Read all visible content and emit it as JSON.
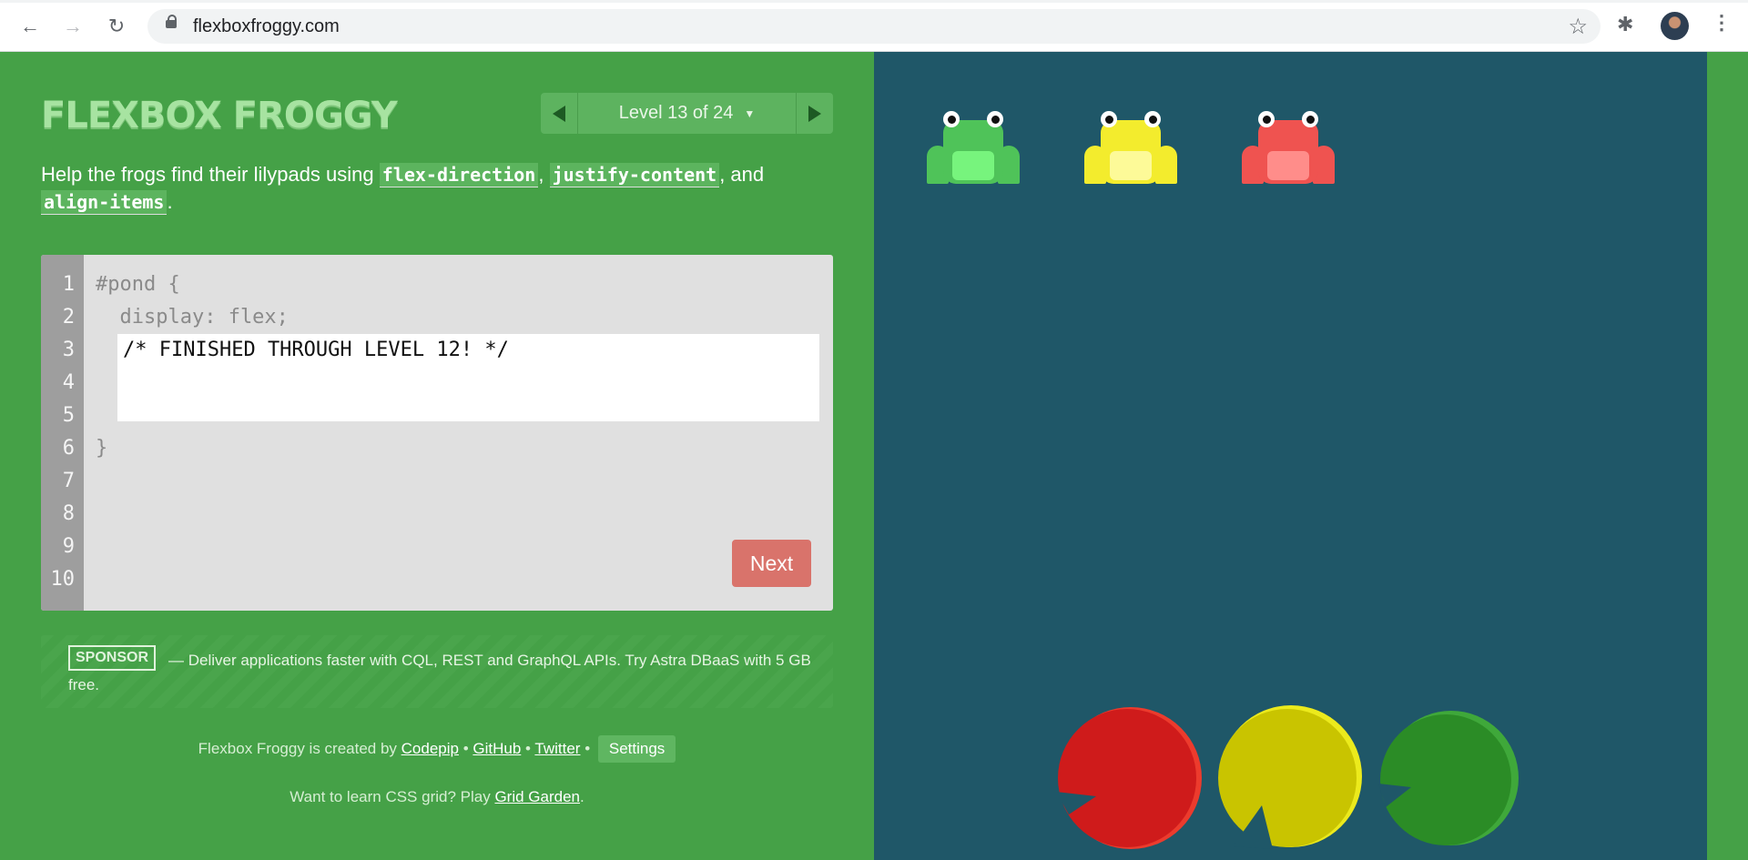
{
  "browser": {
    "url": "flexboxfroggy.com",
    "back_icon": "←",
    "forward_icon": "→",
    "reload_icon": "↻",
    "star_icon": "☆",
    "extensions_icon": "✱",
    "menu_icon": "⋮"
  },
  "game": {
    "logo": "FLEXBOX FROGGY",
    "level_label": "Level 13 of 24",
    "level_caret": "▼",
    "intro_prefix": "Help the frogs find their lilypads using ",
    "intro_code1": "flex-direction",
    "intro_sep1": ", ",
    "intro_code2": "justify-content",
    "intro_sep2": ", and ",
    "intro_code3": "align-items",
    "intro_suffix": ".",
    "editor": {
      "line_numbers": [
        "1",
        "2",
        "3",
        "4",
        "5",
        "6",
        "7",
        "8",
        "9",
        "10"
      ],
      "line1": "#pond {",
      "line2": "  display: flex;",
      "input_value": "/* FINISHED THROUGH LEVEL 12! */",
      "line6": "}"
    },
    "next_label": "Next",
    "sponsor": {
      "badge": "SPONSOR",
      "text": "— Deliver applications faster with CQL, REST and GraphQL APIs. Try Astra DBaaS with 5 GB free."
    },
    "footer": {
      "created_prefix": "Flexbox Froggy is created by ",
      "codepip": "Codepip",
      "dot1": " • ",
      "github": "GitHub",
      "dot2": " • ",
      "twitter": "Twitter",
      "dot3": " • ",
      "settings": "Settings",
      "grid_prefix": "Want to learn CSS grid? Play ",
      "grid_link": "Grid Garden",
      "grid_suffix": "."
    }
  },
  "pond": {
    "frogs": [
      {
        "color": "green",
        "body": "#4fc359",
        "belly": "#77f47d"
      },
      {
        "color": "yellow",
        "body": "#f3ec2d",
        "belly": "#fdfa98"
      },
      {
        "color": "red",
        "body": "#ef5350",
        "belly": "#ff8d8a"
      }
    ],
    "lilypads": [
      {
        "color": "red",
        "fill": "#cf1b1b",
        "rim": "#ec3b2d"
      },
      {
        "color": "yellow",
        "fill": "#c9c400",
        "rim": "#ecea1c"
      },
      {
        "color": "green",
        "fill": "#2b8c26",
        "rim": "#3fa83a"
      }
    ]
  }
}
